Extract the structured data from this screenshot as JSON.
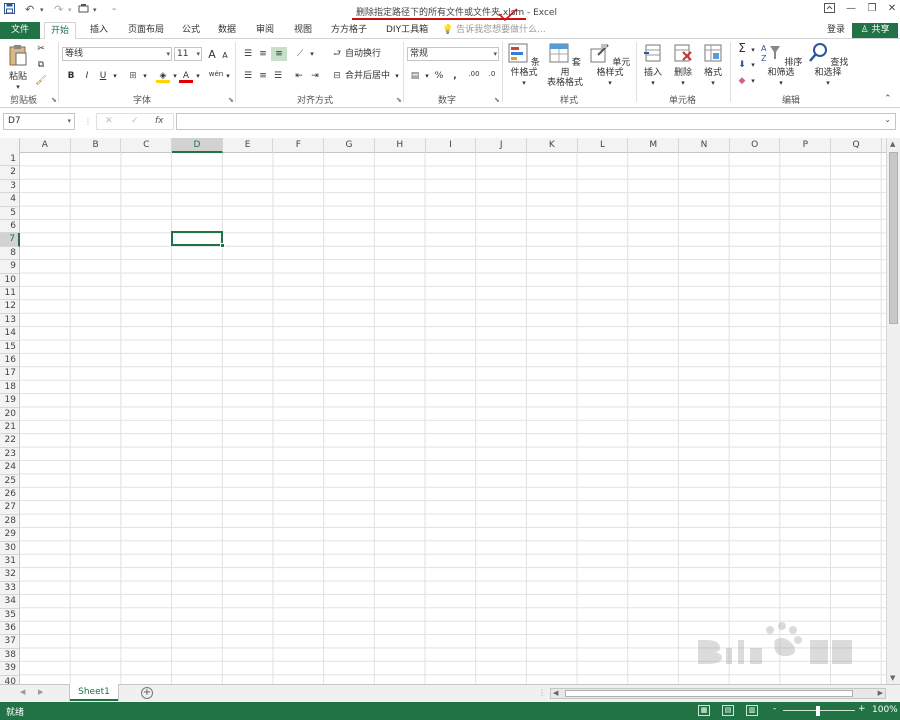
{
  "titlebar": {
    "doc_title": "删除指定路径下的所有文件或文件夹.xlsm - Excel",
    "annotation_color": "#d01010",
    "qat": [
      "save-icon",
      "undo-icon",
      "redo-icon",
      "touch-mode-icon",
      "customize-qat-icon"
    ],
    "window_buttons": [
      "ribbon-display-icon",
      "minimize-icon",
      "restore-icon",
      "close-icon"
    ]
  },
  "tabs": {
    "file": "文件",
    "home": "开始",
    "insert": "插入",
    "page_layout": "页面布局",
    "formulas": "公式",
    "data": "数据",
    "review": "审阅",
    "view": "视图",
    "fangfang": "方方格子",
    "diy": "DIY工具箱",
    "tell_me": "告诉我您想要做什么...",
    "login": "登录",
    "share": "共享"
  },
  "ribbon": {
    "clipboard": {
      "label": "剪贴板",
      "paste": "粘贴"
    },
    "font": {
      "label": "字体",
      "name": "等线",
      "size": "11",
      "bold": "B",
      "italic": "I",
      "underline": "U",
      "grow": "A",
      "shrink": "A",
      "font_color": "A",
      "phonetic": "wén"
    },
    "alignment": {
      "label": "对齐方式",
      "wrap": "自动换行",
      "merge": "合并后居中"
    },
    "number": {
      "label": "数字",
      "format": "常规",
      "percent": "%",
      "comma": ",",
      "inc": ".00",
      "dec": ".0"
    },
    "styles": {
      "label": "样式",
      "conditional": "条件格式",
      "table_line1": "套用",
      "table_line2": "表格格式",
      "cell_styles": "单元格样式"
    },
    "cells": {
      "label": "单元格",
      "insert": "插入",
      "delete": "删除",
      "format": "格式"
    },
    "editing": {
      "label": "编辑",
      "sort": "排序和筛选",
      "find": "查找和选择"
    }
  },
  "formula_bar": {
    "name_box": "D7",
    "cancel": "✕",
    "enter": "✓",
    "fx": "fx",
    "content": ""
  },
  "grid": {
    "columns": [
      "A",
      "B",
      "C",
      "D",
      "E",
      "F",
      "G",
      "H",
      "I",
      "J",
      "K",
      "L",
      "M",
      "N",
      "O",
      "P",
      "Q"
    ],
    "rows": [
      "1",
      "2",
      "3",
      "4",
      "5",
      "6",
      "7",
      "8",
      "9",
      "10",
      "11",
      "12",
      "13",
      "14",
      "15",
      "16",
      "17",
      "18",
      "19",
      "20",
      "21",
      "22",
      "23",
      "24",
      "25",
      "26",
      "27",
      "28",
      "29",
      "30",
      "31",
      "32",
      "33",
      "34",
      "35",
      "36",
      "37",
      "38",
      "39",
      "40"
    ],
    "active_cell": "D7",
    "accent": "#217346"
  },
  "sheets": {
    "tabs": [
      "Sheet1"
    ],
    "active": "Sheet1"
  },
  "statusbar": {
    "status": "就绪",
    "zoom": "100%",
    "zoom_minus": "-",
    "zoom_plus": "+"
  }
}
